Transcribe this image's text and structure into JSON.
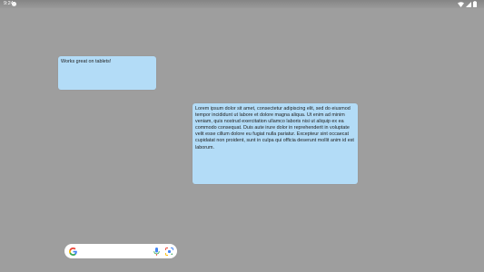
{
  "status_bar": {
    "time": "9:24",
    "notification_icon": "circle-notification-icon",
    "right_icons": [
      "wifi-icon",
      "cell-signal-icon",
      "battery-icon"
    ]
  },
  "notes": [
    {
      "text": "Works great on tablets!"
    },
    {
      "text": "Lorem ipsum dolor sit amet, consectetur adipiscing elit, sed do eiusmod tempor incididunt ut labore et dolore magna aliqua. Ut enim ad minim veniam, quis nostrud exercitation ullamco laboris nisi ut aliquip ex ea commodo consequat. Duis aute irure dolor in reprehenderit in voluptate velit esse cillum dolore eu fugiat nulla pariatur. Excepteur sint occaecat cupidatat non proident, sunt in culpa qui officia deserunt mollit anim id est laborum."
    }
  ],
  "search_bar": {
    "logo_icon": "google-g-icon",
    "mic_icon": "mic-icon",
    "lens_icon": "lens-icon"
  },
  "colors": {
    "background": "#9e9e9e",
    "note_fill": "#b3dcf7",
    "search_bar": "#ffffff"
  }
}
